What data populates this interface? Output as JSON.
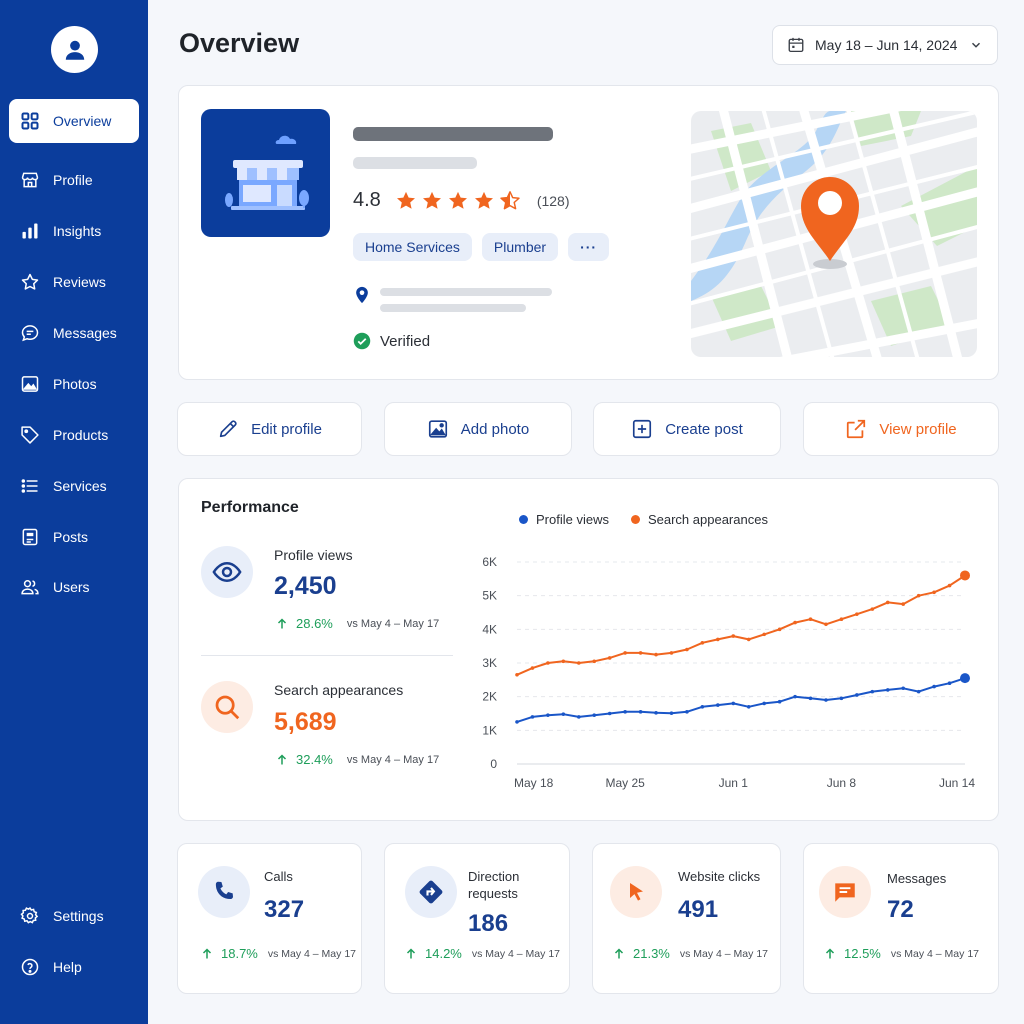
{
  "sidebar": {
    "items": [
      {
        "label": "Overview",
        "icon": "grid-icon"
      },
      {
        "label": "Profile",
        "icon": "store-icon"
      },
      {
        "label": "Insights",
        "icon": "bar-chart-icon"
      },
      {
        "label": "Reviews",
        "icon": "star-icon"
      },
      {
        "label": "Messages",
        "icon": "chat-icon"
      },
      {
        "label": "Photos",
        "icon": "image-icon"
      },
      {
        "label": "Products",
        "icon": "tag-icon"
      },
      {
        "label": "Services",
        "icon": "list-icon"
      },
      {
        "label": "Posts",
        "icon": "post-icon"
      },
      {
        "label": "Users",
        "icon": "users-icon"
      }
    ],
    "settings_label": "Settings",
    "help_label": "Help"
  },
  "header": {
    "title": "Overview",
    "date_range": "May 18 – Jun 14, 2024"
  },
  "business": {
    "rating": "4.8",
    "stars": 4.5,
    "review_count": "(128)",
    "categories": [
      "Home Services",
      "Plumber"
    ],
    "more_label": "···",
    "verified_label": "Verified"
  },
  "actions": {
    "edit": "Edit profile",
    "add_photo": "Add photo",
    "create_post": "Create post",
    "view_profile": "View profile"
  },
  "performance": {
    "title": "Performance",
    "profile_views": {
      "label": "Profile views",
      "value": "2,450",
      "delta": "28.6%",
      "vs": "vs May 4 – May 17"
    },
    "search_appearances": {
      "label": "Search appearances",
      "value": "5,689",
      "delta": "32.4%",
      "vs": "vs May 4 – May 17"
    }
  },
  "chart_data": {
    "type": "line",
    "x_ticks": [
      "May 18",
      "May 25",
      "Jun 1",
      "Jun 8",
      "Jun 14"
    ],
    "y_ticks": [
      "0",
      "1K",
      "2K",
      "3K",
      "4K",
      "5K",
      "6K"
    ],
    "ylim": [
      0,
      6000
    ],
    "grid": true,
    "legend_position": "top",
    "series": [
      {
        "name": "Profile views",
        "color": "#1a56c8",
        "values": [
          1250,
          1400,
          1450,
          1480,
          1400,
          1450,
          1500,
          1550,
          1550,
          1520,
          1510,
          1550,
          1700,
          1750,
          1800,
          1700,
          1800,
          1850,
          2000,
          1950,
          1900,
          1950,
          2050,
          2150,
          2200,
          2250,
          2150,
          2300,
          2400,
          2550
        ]
      },
      {
        "name": "Search appearances",
        "color": "#f0651f",
        "values": [
          2650,
          2850,
          3000,
          3050,
          3000,
          3050,
          3150,
          3300,
          3300,
          3250,
          3300,
          3400,
          3600,
          3700,
          3800,
          3700,
          3850,
          4000,
          4200,
          4300,
          4150,
          4300,
          4450,
          4600,
          4800,
          4750,
          5000,
          5100,
          5300,
          5600
        ]
      }
    ]
  },
  "cards": [
    {
      "label": "Calls",
      "value": "327",
      "delta": "18.7%",
      "vs": "vs May 4 – May 17"
    },
    {
      "label": "Direction requests",
      "value": "186",
      "delta": "14.2%",
      "vs": "vs May 4 – May 17"
    },
    {
      "label": "Website clicks",
      "value": "491",
      "delta": "21.3%",
      "vs": "vs May 4 – May 17"
    },
    {
      "label": "Messages",
      "value": "72",
      "delta": "12.5%",
      "vs": "vs May 4 – May 17"
    }
  ],
  "colors": {
    "primary": "#0b3d9c",
    "accent": "#f0651f",
    "positive": "#1e9e5a"
  }
}
